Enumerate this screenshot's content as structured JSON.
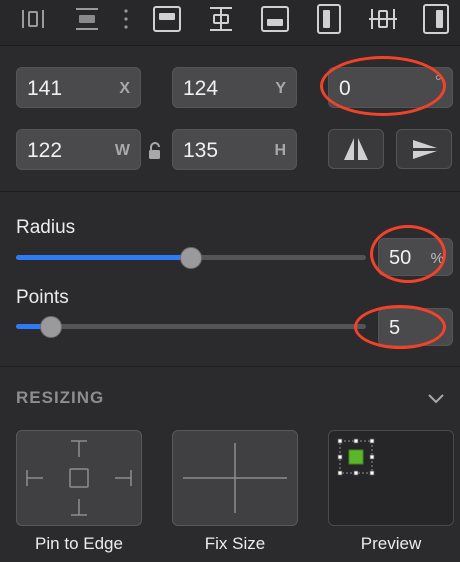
{
  "toolbar": {
    "icons": [
      "distribute-horizontal-icon",
      "distribute-vertical-icon",
      "more-icon",
      "align-top-icon",
      "align-middle-icon",
      "align-bottom-icon",
      "align-left-icon",
      "align-center-icon",
      "align-right-icon"
    ]
  },
  "position": {
    "x": {
      "value": "141",
      "label": "X"
    },
    "y": {
      "value": "124",
      "label": "Y"
    },
    "rotation": {
      "value": "0",
      "unit": "°"
    },
    "w": {
      "value": "122",
      "label": "W"
    },
    "h": {
      "value": "135",
      "label": "H"
    }
  },
  "radius": {
    "label": "Radius",
    "value": "50",
    "unit": "%",
    "fraction": 0.5
  },
  "points": {
    "label": "Points",
    "value": "5",
    "fraction": 0.07
  },
  "resizing": {
    "title": "RESIZING",
    "options": [
      {
        "label": "Pin to Edge"
      },
      {
        "label": "Fix Size"
      },
      {
        "label": "Preview"
      }
    ]
  },
  "colors": {
    "accent": "#2f7bf5",
    "annotation": "#f2432a",
    "preview_fill": "#5db52c"
  }
}
